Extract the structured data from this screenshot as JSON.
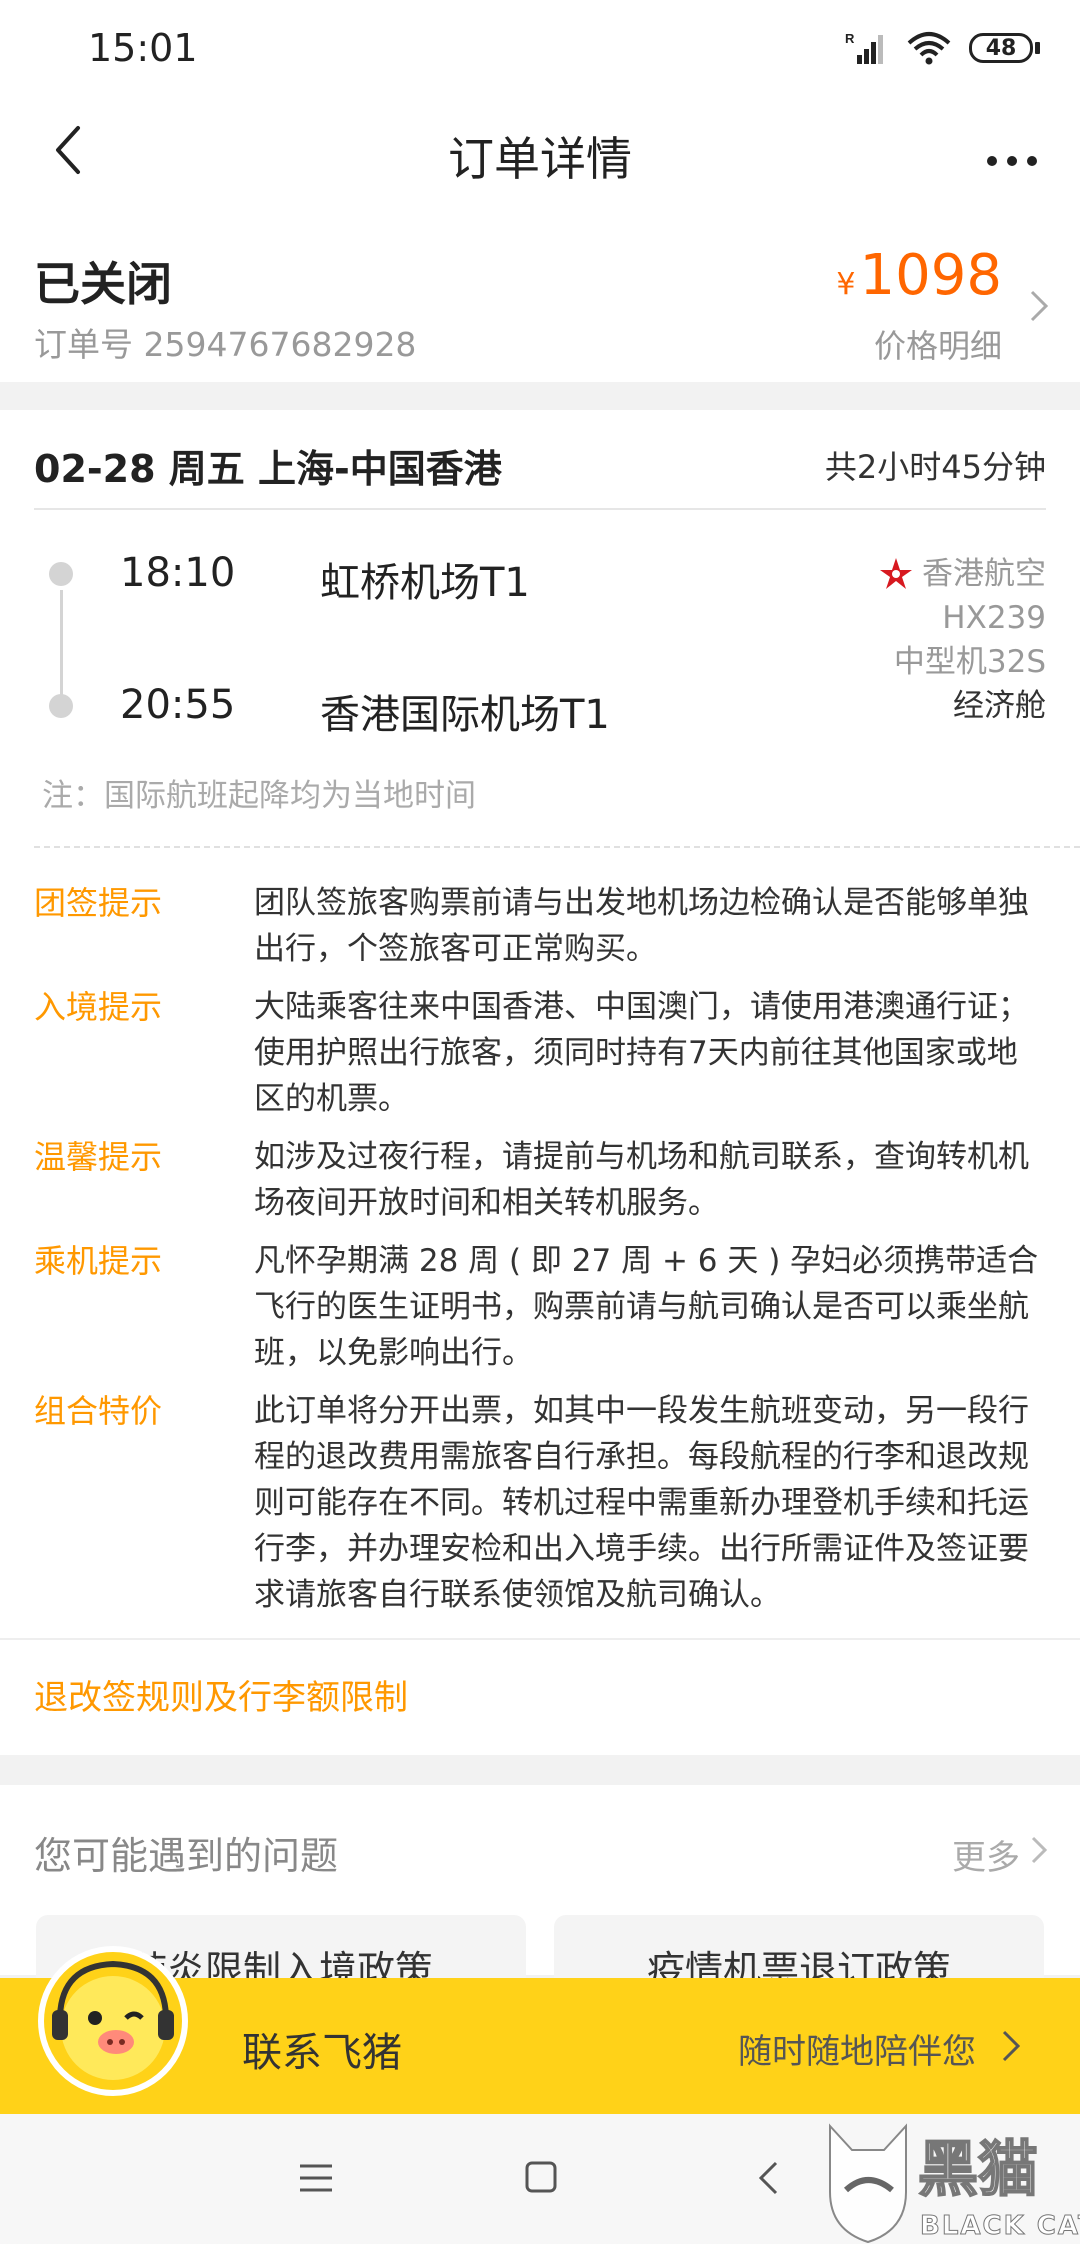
{
  "status_bar": {
    "time": "15:01",
    "signal_label": "R",
    "battery": "48"
  },
  "nav": {
    "title": "订单详情",
    "back_icon": "chevron-left-icon",
    "more_icon": "more-icon"
  },
  "order": {
    "status": "已关闭",
    "order_no": "订单号 2594767682928",
    "price_symbol": "¥",
    "price": "1098",
    "price_detail": "价格明细"
  },
  "flight": {
    "route": "02-28 周五 上海-中国香港",
    "duration": "共2小时45分钟",
    "depart_time": "18:10",
    "depart_airport": "虹桥机场T1",
    "arrive_time": "20:55",
    "arrive_airport": "香港国际机场T1",
    "airline": "香港航空",
    "flight_no": "HX239",
    "aircraft": "中型机32S",
    "cabin": "经济舱",
    "note": "注：国际航班起降均为当地时间"
  },
  "tips": [
    {
      "label": "团签提示",
      "text": "团队签旅客购票前请与出发地机场边检确认是否能够单独出行，个签旅客可正常购买。"
    },
    {
      "label": "入境提示",
      "text": "大陆乘客往来中国香港、中国澳门，请使用港澳通行证；使用护照出行旅客，须同时持有7天内前往其他国家或地区的机票。"
    },
    {
      "label": "温馨提示",
      "text": "如涉及过夜行程，请提前与机场和航司联系，查询转机机场夜间开放时间和相关转机服务。"
    },
    {
      "label": "乘机提示",
      "text": "凡怀孕期满 28 周 ( 即 27 周 + 6 天 ) 孕妇必须携带适合飞行的医生证明书，购票前请与航司确认是否可以乘坐航班，以免影响出行。"
    },
    {
      "label": "组合特价",
      "text": "此订单将分开出票，如其中一段发生航班变动，另一段行程的退改费用需旅客自行承担。每段航程的行李和退改规则可能存在不同。转机过程中需重新办理登机手续和托运行李，并办理安检和出入境手续。出行所需证件及签证要求请旅客自行联系使领馆及航司确认。"
    }
  ],
  "rules_link": "退改签规则及行李额限制",
  "faq": {
    "title": "您可能遇到的问题",
    "more": "更多",
    "items": [
      "肺炎限制入境政策",
      "疫情机票退订政策"
    ]
  },
  "contact": {
    "label": "联系飞猪",
    "sub": "随时随地陪伴您"
  },
  "watermark": {
    "cn": "黑猫",
    "en": "BLACK CAT"
  },
  "colors": {
    "accent": "#ff9800",
    "price": "#ff6600",
    "contact_bar": "#ffd218"
  }
}
